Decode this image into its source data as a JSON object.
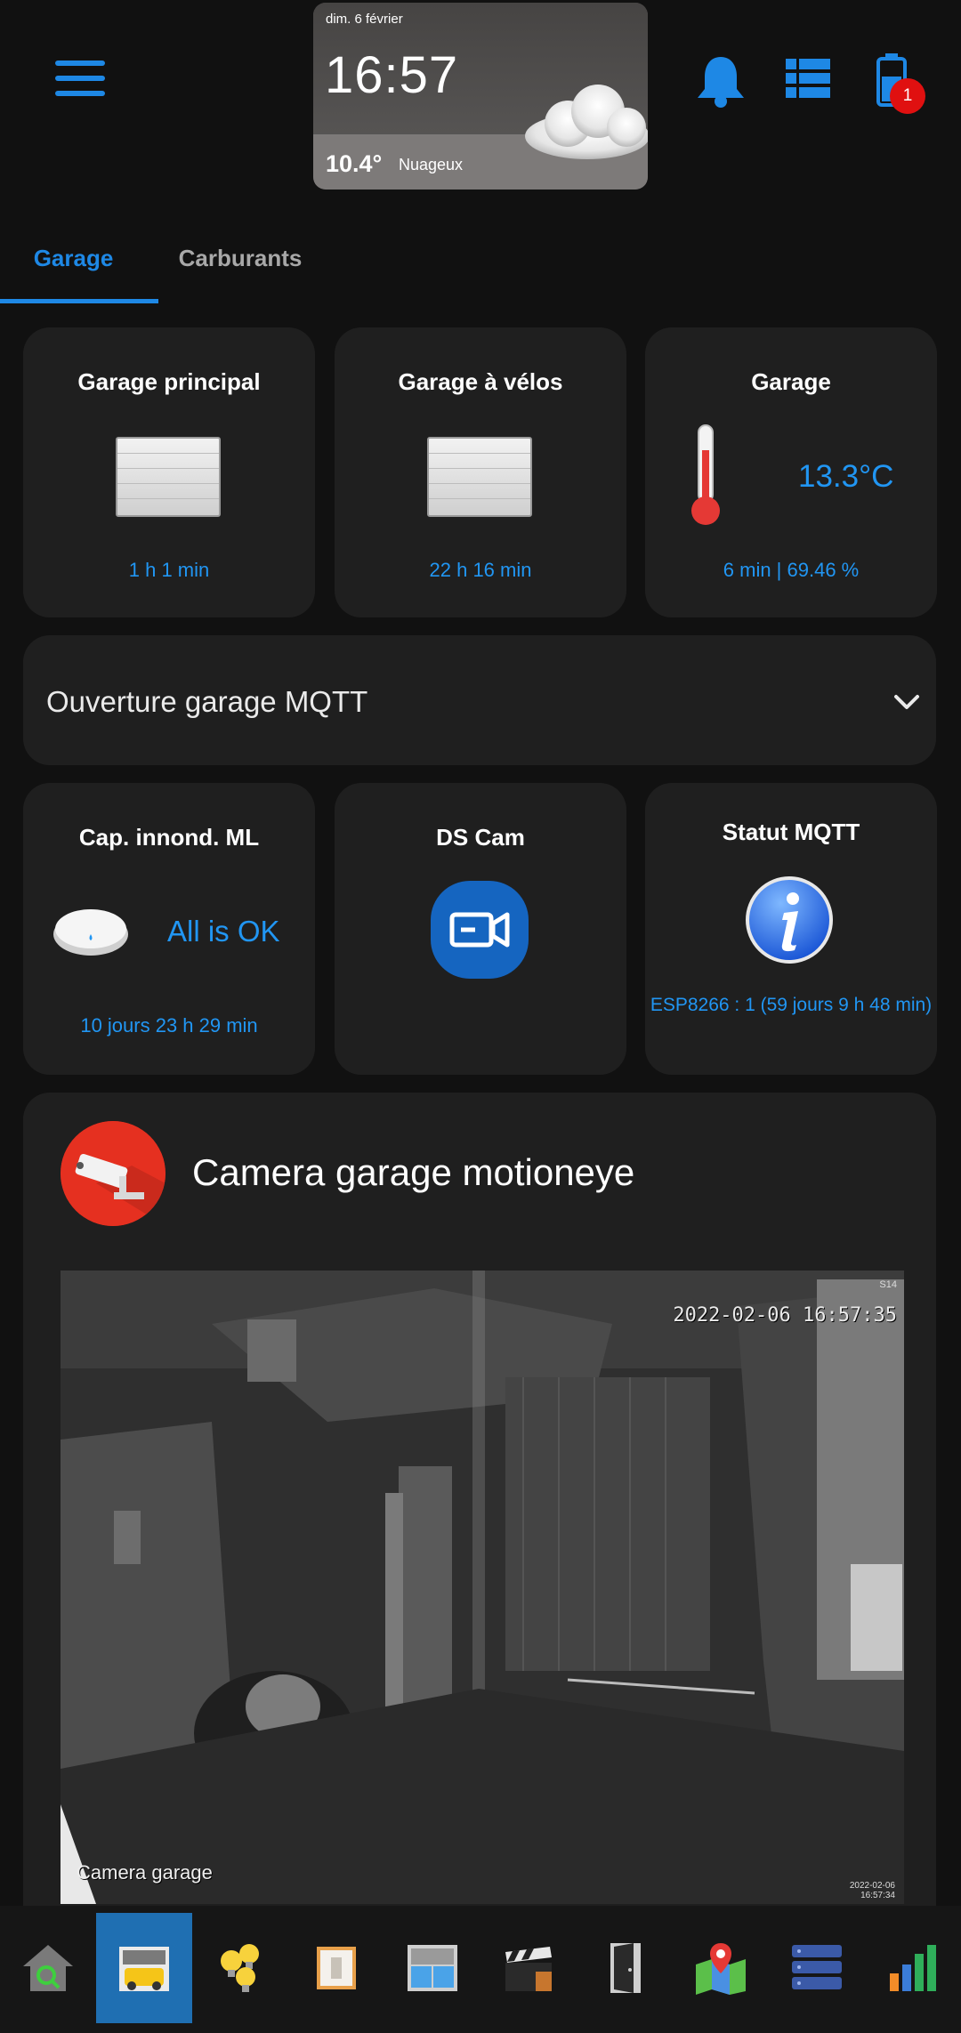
{
  "weather": {
    "date": "dim. 6 février",
    "time": "16:57",
    "temperature": "10.4°",
    "condition": "Nuageux"
  },
  "header": {
    "notification_count": "1"
  },
  "tabs": [
    {
      "label": "Garage",
      "active": true
    },
    {
      "label": "Carburants",
      "active": false
    }
  ],
  "cards": {
    "garage_principal": {
      "title": "Garage principal",
      "status": "1 h 1 min"
    },
    "garage_velos": {
      "title": "Garage à vélos",
      "status": "22 h 16 min"
    },
    "garage_temp": {
      "title": "Garage",
      "value": "13.3°C",
      "status": "6 min | 69.46 %"
    },
    "ouverture": {
      "label": "Ouverture garage MQTT"
    },
    "cap_innond": {
      "title": "Cap. innond. ML",
      "value": "All is OK",
      "status": "10 jours 23 h 29 min"
    },
    "ds_cam": {
      "title": "DS Cam"
    },
    "statut_mqtt": {
      "title": "Statut MQTT",
      "status": "ESP8266 : 1 (59 jours 9 h 48 min)"
    }
  },
  "camera": {
    "title": "Camera garage motioneye",
    "timestamp": "2022-02-06 16:57:35",
    "feed_label": "Camera garage",
    "corner_label": "S14",
    "stamp_date": "2022-02-06",
    "stamp_time": "16:57:34"
  },
  "bottom_nav": [
    {
      "icon": "home-search-icon",
      "active": false
    },
    {
      "icon": "garage-icon",
      "active": true
    },
    {
      "icon": "light-bulbs-icon",
      "active": false
    },
    {
      "icon": "switch-panel-icon",
      "active": false
    },
    {
      "icon": "window-shutter-icon",
      "active": false
    },
    {
      "icon": "clapperboard-icon",
      "active": false
    },
    {
      "icon": "door-icon",
      "active": false
    },
    {
      "icon": "map-pin-icon",
      "active": false
    },
    {
      "icon": "server-icon",
      "active": false
    },
    {
      "icon": "bar-chart-icon",
      "active": false
    }
  ],
  "colors": {
    "accent": "#1e88e5",
    "card_bg": "#1f1f1f",
    "page_bg": "#111111",
    "badge": "#e01010"
  }
}
